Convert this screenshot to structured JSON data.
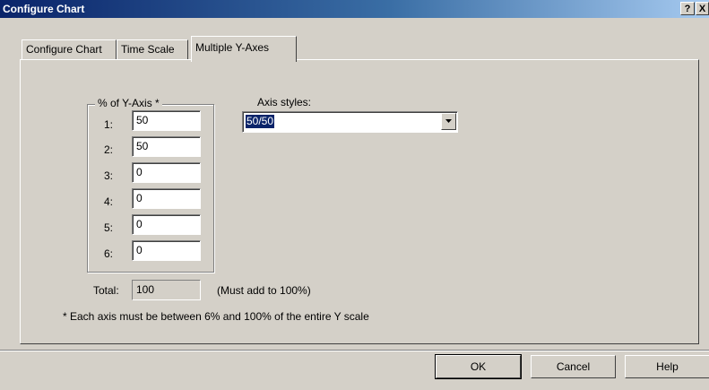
{
  "window": {
    "title": "Configure Chart",
    "help_glyph": "?",
    "close_glyph": "X"
  },
  "tabs": [
    {
      "label": "Configure Chart",
      "active": false
    },
    {
      "label": "Time Scale",
      "active": false
    },
    {
      "label": "Multiple Y-Axes",
      "active": true
    }
  ],
  "group": {
    "label": "% of Y-Axis *",
    "rows": [
      {
        "label": "1:",
        "value": "50"
      },
      {
        "label": "2:",
        "value": "50"
      },
      {
        "label": "3:",
        "value": "0"
      },
      {
        "label": "4:",
        "value": "0"
      },
      {
        "label": "5:",
        "value": "0"
      },
      {
        "label": "6:",
        "value": "0"
      }
    ]
  },
  "axis_styles": {
    "label": "Axis styles:",
    "selected": "50/50"
  },
  "total": {
    "label": "Total:",
    "value": "100",
    "note": "(Must add to 100%)"
  },
  "footnote": "* Each axis must be between 6% and 100% of the entire Y scale",
  "buttons": {
    "ok": "OK",
    "cancel": "Cancel",
    "help": "Help"
  },
  "colors": {
    "titlebar_start": "#0a246a",
    "titlebar_end": "#a6caf0",
    "dialog_bg": "#d4d0c8",
    "selection": "#0a246a"
  },
  "icons": {
    "dropdown": "chevron-down-icon"
  }
}
